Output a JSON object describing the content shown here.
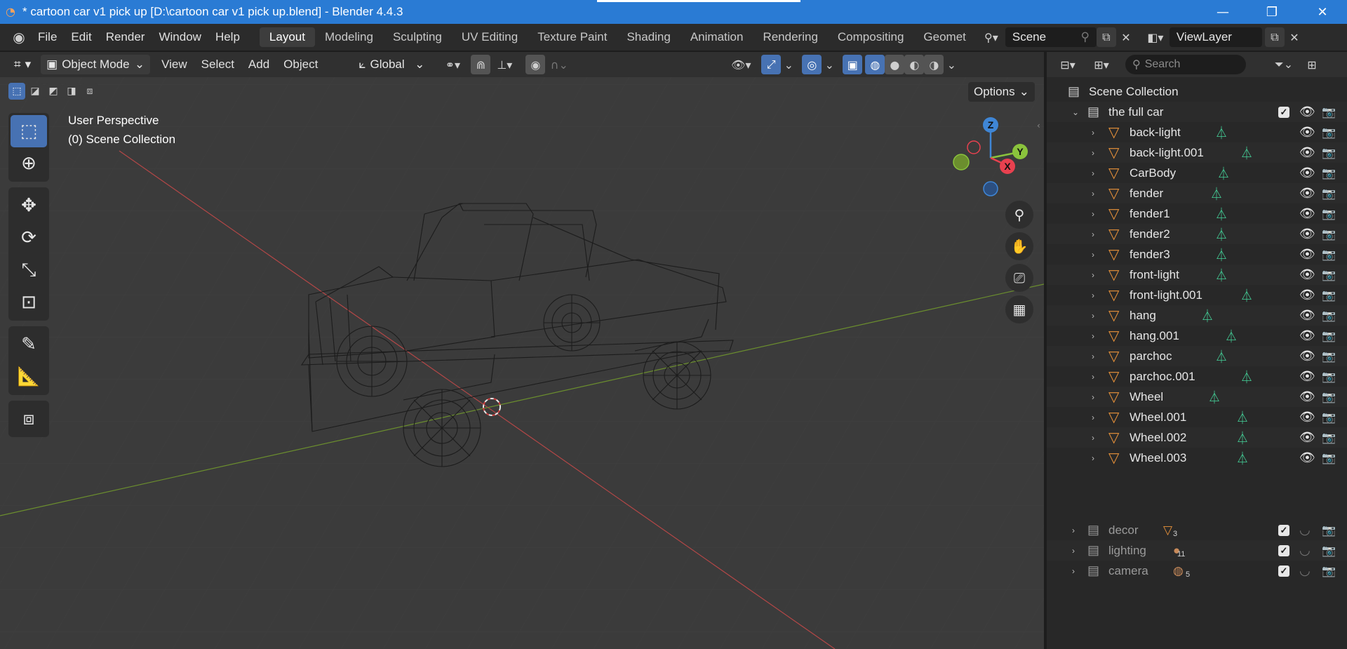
{
  "window": {
    "title": "* cartoon car v1 pick up [D:\\cartoon car v1 pick up.blend] - Blender 4.4.3",
    "minimize": "—",
    "restore": "❐",
    "close": "✕"
  },
  "menu": [
    "File",
    "Edit",
    "Render",
    "Window",
    "Help"
  ],
  "workspaces": [
    "Layout",
    "Modeling",
    "Sculpting",
    "UV Editing",
    "Texture Paint",
    "Shading",
    "Animation",
    "Rendering",
    "Compositing",
    "Geomet"
  ],
  "active_workspace": "Layout",
  "scene_field": "Scene",
  "viewlayer_field": "ViewLayer",
  "viewport_header": {
    "mode": "Object Mode",
    "menus": [
      "View",
      "Select",
      "Add",
      "Object"
    ],
    "orientation": "Global",
    "options": "Options"
  },
  "viewport": {
    "perspective_label": "User Perspective",
    "collection_label": "(0) Scene Collection",
    "gizmo": {
      "x": "X",
      "y": "Y",
      "z": "Z"
    }
  },
  "outliner": {
    "search_placeholder": "Search",
    "root": "Scene Collection",
    "collection": "the full car",
    "objects": [
      "back-light",
      "back-light.001",
      "CarBody",
      "fender",
      "fender1",
      "fender2",
      "fender3",
      "front-light",
      "front-light.001",
      "hang",
      "hang.001",
      "parchoc",
      "parchoc.001",
      "Wheel",
      "Wheel.001",
      "Wheel.002",
      "Wheel.003"
    ],
    "other_collections": [
      {
        "name": "decor",
        "count": "3"
      },
      {
        "name": "lighting",
        "count": "11"
      },
      {
        "name": "camera",
        "count": "5"
      }
    ]
  },
  "colors": {
    "accent": "#4772b3",
    "object_orange": "#e8923a",
    "mesh_green": "#45d39a",
    "axis_x": "#e8414f",
    "axis_y": "#8ac33c",
    "axis_z": "#3f86d6"
  }
}
